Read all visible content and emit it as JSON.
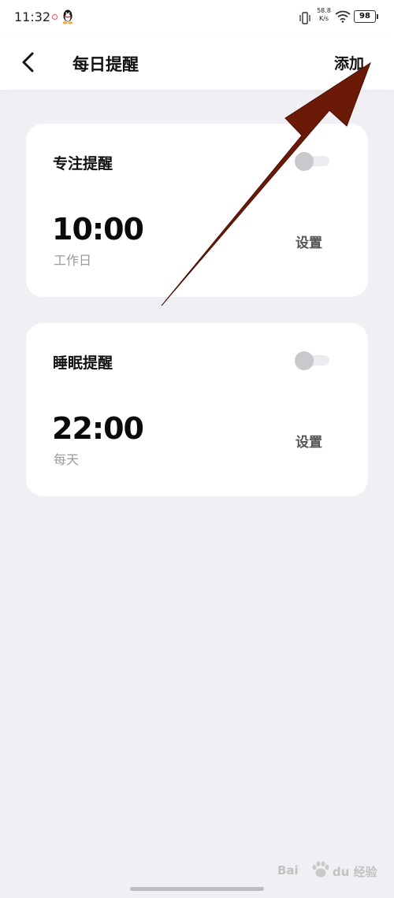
{
  "status_bar": {
    "time": "11:32",
    "net_speed_value": "58.8",
    "net_speed_unit": "K/s",
    "battery": "98"
  },
  "header": {
    "title": "每日提醒",
    "add_label": "添加"
  },
  "reminders": [
    {
      "title": "专注提醒",
      "time": "10:00",
      "repeat": "工作日",
      "setting_label": "设置",
      "enabled": false
    },
    {
      "title": "睡眠提醒",
      "time": "22:00",
      "repeat": "每天",
      "setting_label": "设置",
      "enabled": false
    }
  ],
  "annotation": {
    "arrow_color": "#6b1a07"
  },
  "watermark": {
    "prefix": "Bai",
    "suffix": "du 经验",
    "icon": "paw-icon"
  }
}
